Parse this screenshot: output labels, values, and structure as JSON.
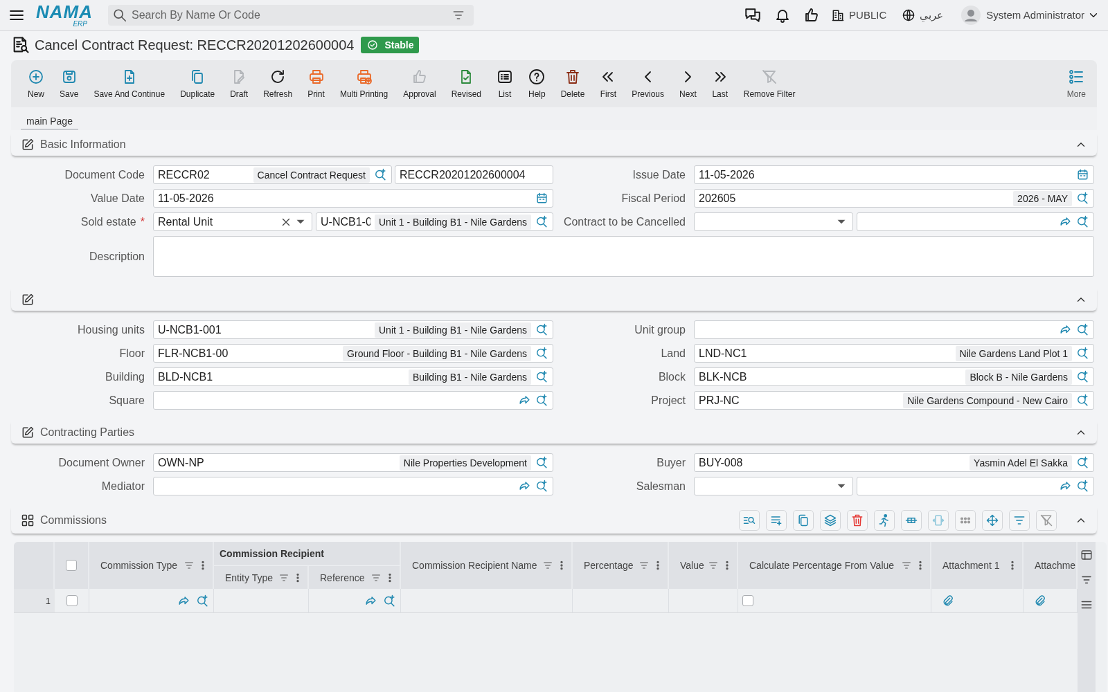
{
  "header": {
    "logo": "NAMA",
    "logo_sub": "ERP",
    "search": {
      "placeholder": "Search By Name Or Code"
    },
    "branch": "PUBLIC",
    "language": "عربي",
    "user": "System Administrator"
  },
  "page_title": "Cancel Contract Request: RECCR20201202600004",
  "status": "Stable",
  "toolbar": [
    {
      "label": "New",
      "kind": "new",
      "disabled": false
    },
    {
      "label": "Save",
      "kind": "save",
      "disabled": false
    },
    {
      "label": "Save And Continue",
      "kind": "savecontinue",
      "disabled": false
    },
    {
      "label": "Duplicate",
      "kind": "duplicate",
      "disabled": false
    },
    {
      "label": "Draft",
      "kind": "draft",
      "disabled": true
    },
    {
      "label": "Refresh",
      "kind": "refresh",
      "disabled": false
    },
    {
      "label": "Print",
      "kind": "print",
      "disabled": false
    },
    {
      "label": "Multi Printing",
      "kind": "multiprint",
      "disabled": false
    },
    {
      "label": "Approval",
      "kind": "approval",
      "disabled": true
    },
    {
      "label": "Revised",
      "kind": "revised",
      "disabled": false
    },
    {
      "label": "List",
      "kind": "list",
      "disabled": false
    },
    {
      "label": "Help",
      "kind": "help",
      "disabled": false
    },
    {
      "label": "Delete",
      "kind": "delete",
      "disabled": false
    },
    {
      "label": "First",
      "kind": "first",
      "disabled": false
    },
    {
      "label": "Previous",
      "kind": "previous",
      "disabled": false
    },
    {
      "label": "Next",
      "kind": "next",
      "disabled": false
    },
    {
      "label": "Last",
      "kind": "last",
      "disabled": false
    },
    {
      "label": "Remove Filter",
      "kind": "removefilter",
      "disabled": true
    },
    {
      "label": "More",
      "kind": "more",
      "disabled": false
    }
  ],
  "tabs": [
    {
      "label": "main Page",
      "selected": true
    }
  ],
  "sections": [
    {
      "title": "Basic Information",
      "kind": "form",
      "expanded": true,
      "rows": [
        [
          {
            "label": "Document Code",
            "kind": "code-pair",
            "value": "RECCR02",
            "description": "Cancel Contract Request",
            "second_value": "RECCR20201202600004"
          },
          {
            "label": "Issue Date",
            "kind": "date",
            "value": "11-05-2026"
          }
        ],
        [
          {
            "label": "Value Date",
            "kind": "date",
            "value": "11-05-2026"
          },
          {
            "label": "Fiscal Period",
            "kind": "lookup",
            "value": "202605",
            "description": "2026 - MAY",
            "share": false
          }
        ],
        [
          {
            "label": "Sold estate",
            "required_mark": "*",
            "kind": "select-lookup",
            "select": {
              "value": "Rental Unit",
              "clearable": true
            },
            "lookup": {
              "value": "U-NCB1-0",
              "description": "Unit 1 - Building B1 - Nile Gardens",
              "share": false
            }
          },
          {
            "label": "Contract to be Cancelled",
            "kind": "select-lookup",
            "select": {
              "clearable": false
            },
            "lookup": {
              "share": true
            }
          }
        ],
        [
          {
            "label": "Description",
            "kind": "textarea"
          }
        ]
      ]
    },
    {
      "kind": "form",
      "expanded": true,
      "rows": [
        [
          {
            "label": "Housing units",
            "kind": "lookup",
            "value": "U-NCB1-001",
            "description": "Unit 1 - Building B1 - Nile Gardens",
            "share": false
          },
          {
            "label": "Unit group",
            "kind": "lookup",
            "share": true
          }
        ],
        [
          {
            "label": "Floor",
            "kind": "lookup",
            "value": "FLR-NCB1-00",
            "description": "Ground Floor - Building B1 - Nile Gardens",
            "share": false
          },
          {
            "label": "Land",
            "kind": "lookup",
            "value": "LND-NC1",
            "description": "Nile Gardens Land Plot 1",
            "share": false
          }
        ],
        [
          {
            "label": "Building",
            "kind": "lookup",
            "value": "BLD-NCB1",
            "description": "Building B1 - Nile Gardens",
            "share": false
          },
          {
            "label": "Block",
            "kind": "lookup",
            "value": "BLK-NCB",
            "description": "Block B - Nile Gardens",
            "share": false
          }
        ],
        [
          {
            "label": "Square",
            "kind": "lookup",
            "share": true
          },
          {
            "label": "Project",
            "kind": "lookup",
            "value": "PRJ-NC",
            "description": "Nile Gardens Compound - New Cairo",
            "share": false
          }
        ]
      ]
    },
    {
      "title": "Contracting Parties",
      "kind": "form",
      "expanded": true,
      "rows": [
        [
          {
            "label": "Document Owner",
            "kind": "lookup",
            "value": "OWN-NP",
            "description": "Nile Properties Development",
            "share": false
          },
          {
            "label": "Buyer",
            "kind": "lookup",
            "value": "BUY-008",
            "description": "Yasmin Adel El Sakka",
            "share": false
          }
        ],
        [
          {
            "label": "Mediator",
            "kind": "lookup",
            "share": true
          },
          {
            "label": "Salesman",
            "kind": "select-lookup",
            "select": {
              "clearable": false
            },
            "lookup": {
              "share": true
            }
          }
        ]
      ]
    },
    {
      "title": "Commissions",
      "kind": "grid",
      "expanded": true,
      "table": {
        "all_checked": false,
        "columns": [
          {
            "label": "Commission Type",
            "kind": "lookup",
            "filterable": true,
            "menu": true
          },
          {
            "group": "Commission Recipient",
            "children": [
              {
                "label": "Entity Type",
                "kind": "text",
                "filterable": true,
                "menu": true
              },
              {
                "label": "Reference",
                "kind": "lookup",
                "filterable": true,
                "menu": true
              }
            ]
          },
          {
            "label": "Commission Recipient Name",
            "kind": "text",
            "filterable": true,
            "menu": true
          },
          {
            "label": "Percentage",
            "kind": "text",
            "filterable": true,
            "menu": true
          },
          {
            "label": "Value",
            "kind": "text",
            "filterable": true,
            "menu": true
          },
          {
            "label": "Calculate Percentage From Value",
            "kind": "checkbox",
            "filterable": true,
            "menu": true
          },
          {
            "label": "Attachment 1",
            "kind": "attachment",
            "filterable": false,
            "menu": true
          },
          {
            "label": "Attachme",
            "kind": "attachment"
          }
        ],
        "rows": [
          {
            "number": "1",
            "checked": false,
            "calculate_percentage_from_value": false
          }
        ]
      }
    }
  ]
}
